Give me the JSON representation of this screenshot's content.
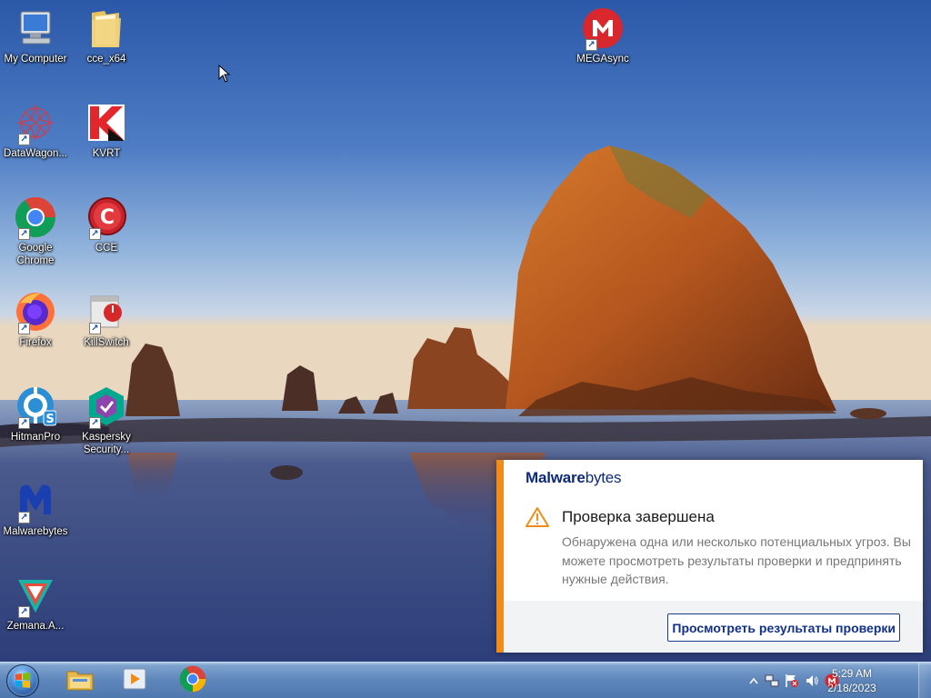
{
  "desktop": {
    "icons": [
      {
        "label": "My Computer",
        "icon": "computer-icon"
      },
      {
        "label": "cce_x64",
        "icon": "folder-icon"
      },
      {
        "label": "DataWagon...",
        "icon": "datawagon-icon"
      },
      {
        "label": "KVRT",
        "icon": "kvrt-icon"
      },
      {
        "label": "Google\nChrome",
        "icon": "chrome-icon"
      },
      {
        "label": "CCE",
        "icon": "cce-icon"
      },
      {
        "label": "Firefox",
        "icon": "firefox-icon"
      },
      {
        "label": "KillSwitch",
        "icon": "killswitch-icon"
      },
      {
        "label": "HitmanPro",
        "icon": "hitmanpro-icon"
      },
      {
        "label": "Kaspersky\nSecurity...",
        "icon": "kaspersky-icon"
      },
      {
        "label": "Malwarebytes",
        "icon": "malwarebytes-icon"
      },
      {
        "label": "Zemana.A...",
        "icon": "zemana-icon"
      },
      {
        "label": "MEGAsync",
        "icon": "megasync-icon"
      }
    ]
  },
  "notification": {
    "brand_bold": "Malware",
    "brand_light": "bytes",
    "title": "Проверка завершена",
    "body": "Обнаружена одна или несколько потенциальных угроз. Вы можете просмотреть результаты проверки и предпринять нужные действия.",
    "action_label": "Просмотреть результаты проверки",
    "accent_color": "#f08c1a"
  },
  "taskbar": {
    "pinned": [
      {
        "name": "explorer",
        "icon": "explorer-folder-icon"
      },
      {
        "name": "media-player",
        "icon": "media-player-icon"
      },
      {
        "name": "chrome",
        "icon": "chrome-icon"
      }
    ],
    "tray": {
      "time": "5:29 AM",
      "date": "2/18/2023",
      "icons": [
        "show-hidden-icons-arrow",
        "network-icon",
        "action-center-flag-icon",
        "volume-icon",
        "mega-tray-icon"
      ]
    }
  }
}
